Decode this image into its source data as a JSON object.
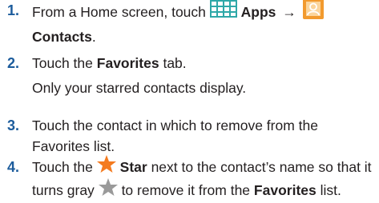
{
  "steps": [
    {
      "number": "1.",
      "line1_prefix": "From a Home screen, touch",
      "apps_label": "Apps",
      "arrow": "→",
      "line2_bold": "Contacts",
      "line2_suffix": ".",
      "icons": [
        "apps-grid-icon",
        "contacts-icon"
      ]
    },
    {
      "number": "2.",
      "prefix": "Touch the",
      "bold": "Favorites",
      "suffix": "tab.",
      "note": "Only your starred contacts display."
    },
    {
      "number": "3.",
      "line1": "Touch the contact in which to remove from the",
      "line2": "Favorites list."
    },
    {
      "number": "4.",
      "prefix": "Touch the",
      "star_label": "Star",
      "line1_suffix": "next to the contact’s name so that it",
      "line2_prefix": "turns gray",
      "line2_middle": "to remove it from the",
      "line2_bold": "Favorites",
      "line2_suffix": "list.",
      "icons": [
        "orange-star-icon",
        "gray-star-icon"
      ]
    }
  ],
  "colors": {
    "step_number": "#1c5c9c",
    "text": "#231f20",
    "apps_icon": "#2ea8a8",
    "contacts_icon_bg": "#f29a2e",
    "star_orange": "#f47b20",
    "star_gray": "#9a9a9a"
  }
}
